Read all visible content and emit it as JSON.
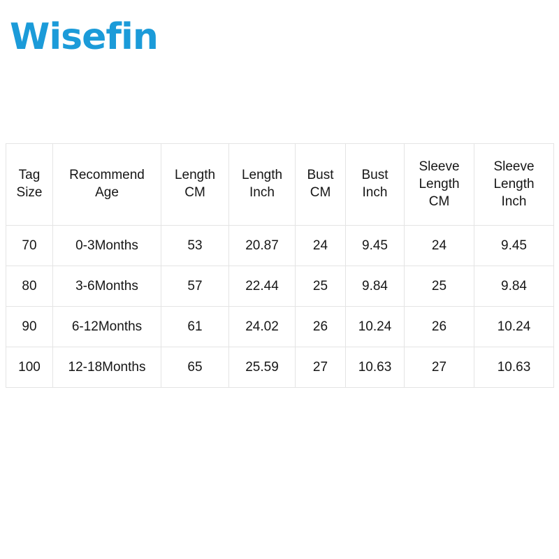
{
  "brand": {
    "name": "Wisefin",
    "color": "#1b9bd9",
    "icon": "wisefin-wordmark"
  },
  "size_chart": {
    "columns": [
      {
        "id": "tag-size",
        "lines": [
          "Tag",
          "Size"
        ]
      },
      {
        "id": "recommend-age",
        "lines": [
          "Recommend",
          "Age"
        ]
      },
      {
        "id": "length-cm",
        "lines": [
          "Length",
          "CM"
        ]
      },
      {
        "id": "length-inch",
        "lines": [
          "Length",
          "Inch"
        ]
      },
      {
        "id": "bust-cm",
        "lines": [
          "Bust",
          "CM"
        ]
      },
      {
        "id": "bust-inch",
        "lines": [
          "Bust",
          "Inch"
        ]
      },
      {
        "id": "sleeve-length-cm",
        "lines": [
          "Sleeve",
          "Length",
          "CM"
        ]
      },
      {
        "id": "sleeve-length-inch",
        "lines": [
          "Sleeve",
          "Length",
          "Inch"
        ]
      }
    ],
    "rows": [
      {
        "tag_size": "70",
        "recommend_age": "0-3Months",
        "length_cm": "53",
        "length_inch": "20.87",
        "bust_cm": "24",
        "bust_inch": "9.45",
        "sleeve_length_cm": "24",
        "sleeve_length_inch": "9.45"
      },
      {
        "tag_size": "80",
        "recommend_age": "3-6Months",
        "length_cm": "57",
        "length_inch": "22.44",
        "bust_cm": "25",
        "bust_inch": "9.84",
        "sleeve_length_cm": "25",
        "sleeve_length_inch": "9.84"
      },
      {
        "tag_size": "90",
        "recommend_age": "6-12Months",
        "length_cm": "61",
        "length_inch": "24.02",
        "bust_cm": "26",
        "bust_inch": "10.24",
        "sleeve_length_cm": "26",
        "sleeve_length_inch": "10.24"
      },
      {
        "tag_size": "100",
        "recommend_age": "12-18Months",
        "length_cm": "65",
        "length_inch": "25.59",
        "bust_cm": "27",
        "bust_inch": "10.63",
        "sleeve_length_cm": "27",
        "sleeve_length_inch": "10.63"
      }
    ]
  },
  "style": {
    "border_color": "#e4e4e4",
    "text_color": "#161616",
    "background": "#ffffff"
  }
}
